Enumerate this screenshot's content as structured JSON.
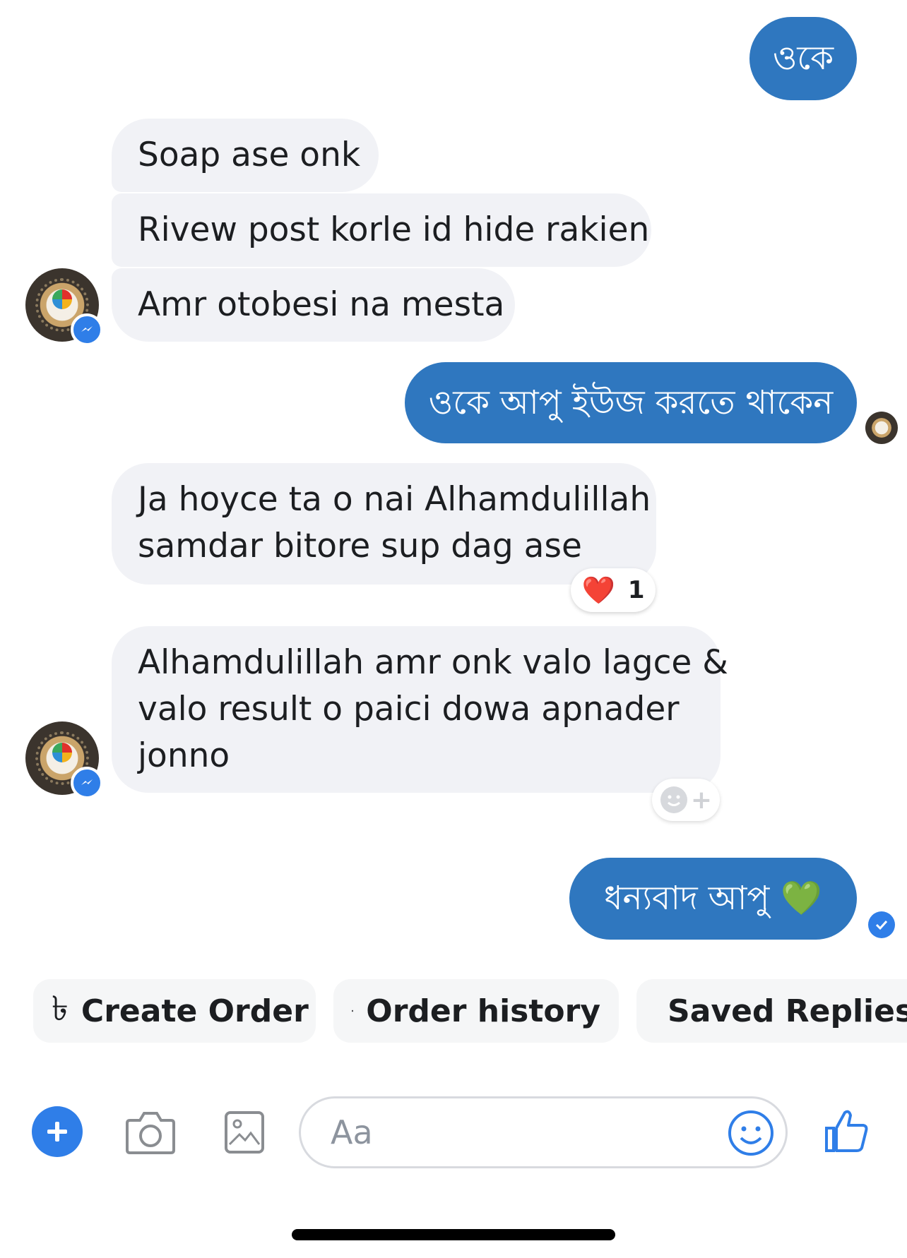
{
  "colors": {
    "outgoing_bubble": "#2f77bf",
    "incoming_bubble": "#f1f2f6",
    "accent": "#2f7ee8"
  },
  "messages": {
    "m1_out": "ওকে",
    "m2_in": "Soap ase onk",
    "m3_in": "Rivew post korle id hide rakien",
    "m4_in": "Amr otobesi na mesta",
    "m5_out": "ওকে আপু ইউজ করতে থাকেন",
    "m6_in_line1": "Ja hoyce ta o nai Alhamdulillah",
    "m6_in_line2": "samdar bitore sup dag ase",
    "m6_reaction_emoji": "❤️",
    "m6_reaction_count": "1",
    "m7_in_line1": "Alhamdulillah amr onk valo lagce &",
    "m7_in_line2": "valo result o paici dowa apnader",
    "m7_in_line3": "jonno",
    "m7_add_reaction": "+",
    "m8_out_text": "ধন্যবাদ আপু",
    "m8_out_emoji": "💚"
  },
  "quick_actions": {
    "create_order_icon_glyph": "৳",
    "create_order": "Create Order",
    "order_history": "Order history",
    "saved_replies": "Saved Replies"
  },
  "composer": {
    "placeholder": "Aa",
    "icons": [
      "plus-icon",
      "camera-icon",
      "image-icon",
      "emoji-icon",
      "thumbs-up-icon"
    ]
  }
}
